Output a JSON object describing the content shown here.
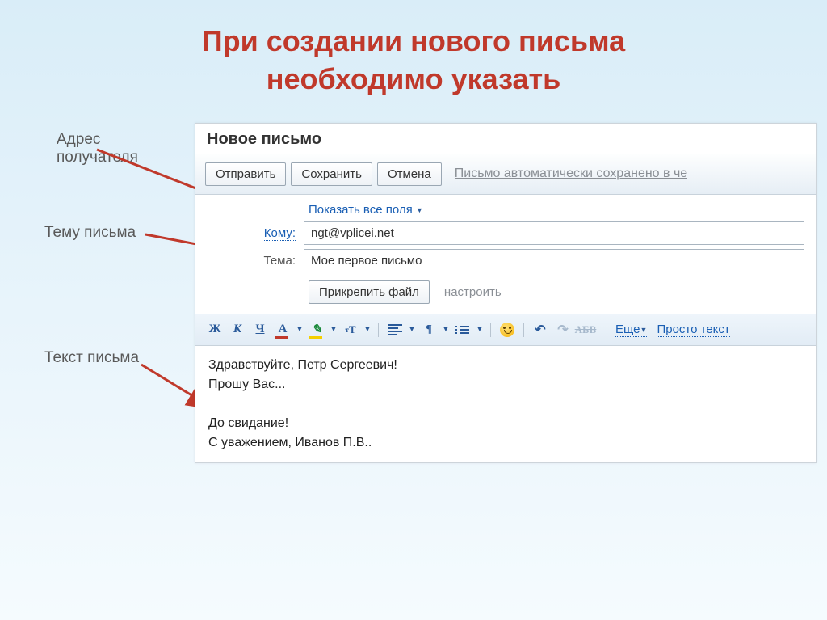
{
  "slide": {
    "title_line1": "При создании нового письма",
    "title_line2": "необходимо указать"
  },
  "annotations": {
    "recipient": "Адрес\nполучателя",
    "subject": "Тему письма",
    "body": "Текст письма"
  },
  "email": {
    "window_title": "Новое письмо",
    "toolbar": {
      "send": "Отправить",
      "save": "Сохранить",
      "cancel": "Отмена",
      "status": "Письмо автоматически сохранено в че"
    },
    "show_all_fields": "Показать все поля",
    "to_label": "Кому:",
    "to_value": "ngt@vplicei.net",
    "subject_label": "Тема:",
    "subject_value": "Мое первое письмо",
    "attach_button": "Прикрепить файл",
    "attach_configure": "настроить",
    "format_bar": {
      "bold": "Ж",
      "italic": "К",
      "underline": "Ч",
      "font_color": "A",
      "highlight": "A",
      "more": "Еще",
      "plain_text": "Просто текст",
      "abv": "АБВ"
    },
    "body_lines": [
      "Здравствуйте, Петр Сергеевич!",
      "Прошу Вас...",
      "",
      "До свидание!",
      "С уважением, Иванов П.В.."
    ]
  }
}
